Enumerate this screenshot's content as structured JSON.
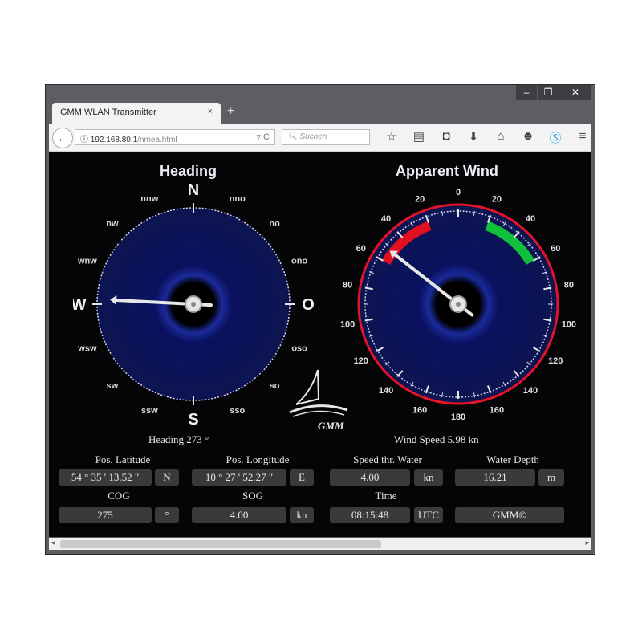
{
  "browser": {
    "tab_title": "GMM WLAN Transmitter",
    "tab_close": "×",
    "new_tab": "+",
    "url_host": "192.168.80.1",
    "url_path": "/nmea.html",
    "search_placeholder": "Suchen",
    "window_controls": [
      "–",
      "❐",
      "✕"
    ]
  },
  "heading": {
    "title": "Heading",
    "caption": "Heading 273 °",
    "value_deg": 273,
    "cardinals": {
      "n": "N",
      "o": "O",
      "s": "S",
      "w": "W"
    },
    "intercardinals": [
      "nno",
      "no",
      "ono",
      "oso",
      "so",
      "sso",
      "ssw",
      "sw",
      "wsw",
      "wnw",
      "nw",
      "nnw"
    ]
  },
  "wind": {
    "title": "Apparent Wind",
    "caption": "Wind Speed 5.98 kn",
    "angle_deg": -52,
    "scale_labels": [
      "0",
      "20",
      "40",
      "60",
      "80",
      "100",
      "120",
      "140",
      "160",
      "180",
      "160",
      "140",
      "120",
      "100",
      "80",
      "60",
      "40",
      "20"
    ]
  },
  "logo_text": "GMM",
  "fields": {
    "lat_label": "Pos. Latitude",
    "lat_value": "54 ° 35 ' 13.52 \"",
    "lat_hemi": "N",
    "lon_label": "Pos. Longitude",
    "lon_value": "10 ° 27 ' 52.27 \"",
    "lon_hemi": "E",
    "stw_label": "Speed thr. Water",
    "stw_value": "4.00",
    "stw_unit": "kn",
    "depth_label": "Water Depth",
    "depth_value": "16.21",
    "depth_unit": "m",
    "cog_label": "COG",
    "cog_value": "275",
    "cog_unit": "°",
    "sog_label": "SOG",
    "sog_value": "4.00",
    "sog_unit": "kn",
    "time_label": "Time",
    "time_value": "08:15:48",
    "time_unit": "UTC",
    "brand_value": "GMM©"
  },
  "colors": {
    "dial_blue": "#0c1450",
    "red_ring": "#e3132a",
    "port_red": "#e01020",
    "starboard_green": "#10c03a"
  }
}
